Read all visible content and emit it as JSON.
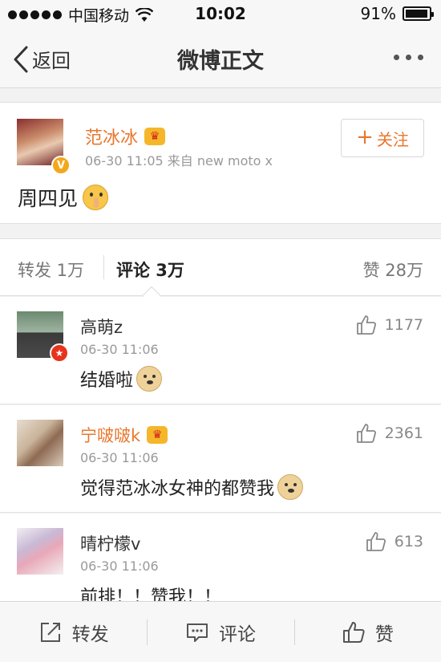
{
  "status_bar": {
    "carrier": "中国移动",
    "time": "10:02",
    "battery": "91%",
    "battery_level": 0.91
  },
  "nav": {
    "back_label": "返回",
    "title": "微博正文"
  },
  "post": {
    "author": "范冰冰",
    "meta": "06-30 11:05  来自 new moto x",
    "follow_label": "关注",
    "text": "周四见",
    "verified_mark": "V"
  },
  "tabs": {
    "repost": "转发 1万",
    "comment": "评论 3万",
    "like": "赞 28万"
  },
  "comments": [
    {
      "name": "高萌z",
      "time": "06-30 11:06",
      "text": "结婚啦",
      "likes": "1177"
    },
    {
      "name": "宁啵啵k",
      "time": "06-30 11:06",
      "text": "觉得范冰冰女神的都赞我",
      "likes": "2361"
    },
    {
      "name": "晴柠檬v",
      "time": "06-30 11:06",
      "text": "前排！！赞我！！",
      "likes": "613"
    }
  ],
  "toolbar": {
    "repost": "转发",
    "comment": "评论",
    "like": "赞"
  },
  "colors": {
    "accent_orange": "#e8772d",
    "verified_gold": "#f3a81b",
    "background": "#f2f2f2"
  },
  "icons": {
    "back": "chevron-left-icon",
    "more": "more-dots-icon",
    "crown": "vip-crown-icon",
    "thumb": "thumb-up-icon",
    "repost": "share-arrow-icon",
    "comment": "comment-bubble-icon"
  }
}
